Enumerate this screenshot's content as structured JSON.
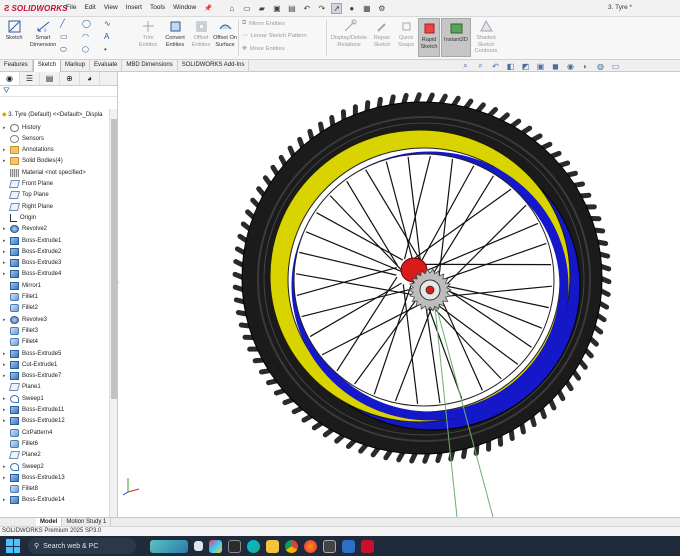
{
  "app": {
    "logo_text": "SOLIDWORKS",
    "doc_title": "3. Tyre *"
  },
  "menu": [
    "File",
    "Edit",
    "View",
    "Insert",
    "Tools",
    "Window"
  ],
  "commands": {
    "sketch": "Sketch",
    "smart_dimension": "Smart Dimension",
    "trim_entities": "Trim Entities",
    "convert_entities": "Convert Entities",
    "offset_entities": "Offset Entities",
    "offset_on_surface": "Offset On Surface",
    "mirror_entities": "Mirror Entities",
    "linear_sketch_pattern": "Linear Sketch Pattern",
    "move_entities": "Move Entities",
    "display_delete_relations": "Display/Delete Relations",
    "repair_sketch": "Repair Sketch",
    "quick_snaps": "Quick Snaps",
    "rapid_sketch": "Rapid Sketch",
    "instant2d": "Instant2D",
    "shaded_sketch_contours": "Shaded Sketch Contours"
  },
  "tabs": [
    "Features",
    "Sketch",
    "Markup",
    "Evaluate",
    "MBD Dimensions",
    "SOLIDWORKS Add-Ins"
  ],
  "active_tab": "Sketch",
  "tree": {
    "root": "3. Tyre (Default) <<Default>_Displa",
    "items": [
      {
        "label": "History",
        "icon": "history-icon",
        "exp": true
      },
      {
        "label": "Sensors",
        "icon": "sensors-icon",
        "exp": false
      },
      {
        "label": "Annotations",
        "icon": "annotations-icon",
        "exp": true
      },
      {
        "label": "Solid Bodies(4)",
        "icon": "solid-bodies-icon",
        "exp": true
      },
      {
        "label": "Material <not specified>",
        "icon": "material-icon",
        "exp": false
      },
      {
        "label": "Front Plane",
        "icon": "plane-icon",
        "exp": false
      },
      {
        "label": "Top Plane",
        "icon": "plane-icon",
        "exp": false
      },
      {
        "label": "Right Plane",
        "icon": "plane-icon",
        "exp": false
      },
      {
        "label": "Origin",
        "icon": "origin-icon",
        "exp": false
      },
      {
        "label": "Revolve2",
        "icon": "revolve-icon",
        "exp": true
      },
      {
        "label": "Boss-Extrude1",
        "icon": "extrude-icon",
        "exp": true
      },
      {
        "label": "Boss-Extrude2",
        "icon": "extrude-icon",
        "exp": true
      },
      {
        "label": "Boss-Extrude3",
        "icon": "extrude-icon",
        "exp": true
      },
      {
        "label": "Boss-Extrude4",
        "icon": "extrude-icon",
        "exp": true
      },
      {
        "label": "Mirror1",
        "icon": "mirror-icon",
        "exp": false
      },
      {
        "label": "Fillet1",
        "icon": "fillet-icon",
        "exp": false
      },
      {
        "label": "Fillet2",
        "icon": "fillet-icon",
        "exp": false
      },
      {
        "label": "Revolve3",
        "icon": "revolve-icon",
        "exp": true
      },
      {
        "label": "Fillet3",
        "icon": "fillet-icon",
        "exp": false
      },
      {
        "label": "Fillet4",
        "icon": "fillet-icon",
        "exp": false
      },
      {
        "label": "Boss-Extrude5",
        "icon": "extrude-icon",
        "exp": true
      },
      {
        "label": "Cut-Extrude1",
        "icon": "cut-extrude-icon",
        "exp": true
      },
      {
        "label": "Boss-Extrude7",
        "icon": "extrude-icon",
        "exp": true
      },
      {
        "label": "Plane1",
        "icon": "plane-icon",
        "exp": false
      },
      {
        "label": "Sweep1",
        "icon": "sweep-icon",
        "exp": true
      },
      {
        "label": "Boss-Extrude11",
        "icon": "extrude-icon",
        "exp": true
      },
      {
        "label": "Boss-Extrude12",
        "icon": "extrude-icon",
        "exp": true
      },
      {
        "label": "CirPattern4",
        "icon": "pattern-icon",
        "exp": false
      },
      {
        "label": "Fillet6",
        "icon": "fillet-icon",
        "exp": false
      },
      {
        "label": "Plane2",
        "icon": "plane-icon",
        "exp": false
      },
      {
        "label": "Sweep2",
        "icon": "sweep-icon",
        "exp": true
      },
      {
        "label": "Boss-Extrude13",
        "icon": "extrude-icon",
        "exp": true
      },
      {
        "label": "Fillet8",
        "icon": "fillet-icon",
        "exp": false
      },
      {
        "label": "Boss-Extrude14",
        "icon": "extrude-icon",
        "exp": true
      }
    ]
  },
  "bottom_tabs": [
    "Model",
    "Motion Study 1"
  ],
  "status": "SOLIDWORKS Premium 2025 SP3.0",
  "taskbar": {
    "search_placeholder": "Search web & PC"
  },
  "colors": {
    "tyre": "#1b1b1b",
    "rim_yellow": "#d9d400",
    "rim_blue": "#1418c8",
    "hub_red": "#d81b1b",
    "taskbar": "#1f2a3a"
  }
}
